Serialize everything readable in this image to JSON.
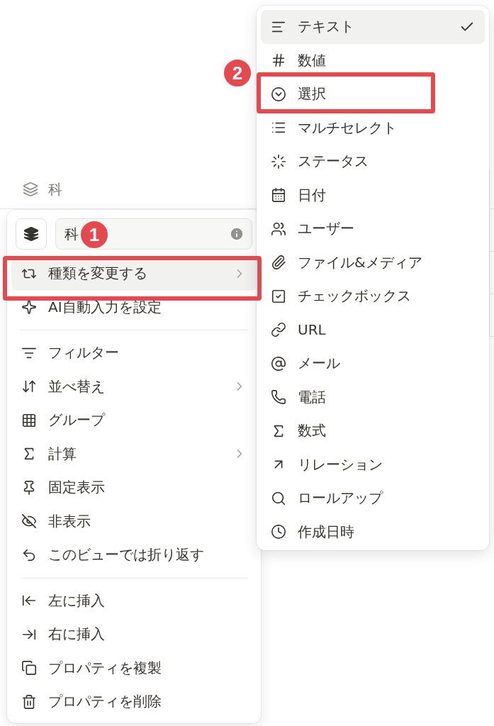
{
  "table": {
    "header": {
      "label": "科"
    }
  },
  "property_menu": {
    "name_field": {
      "value": "科"
    },
    "sections": [
      {
        "items": [
          {
            "label": "種類を変更する",
            "submenu": true,
            "highlighted": true
          },
          {
            "label": "AI自動入力を設定",
            "submenu": false,
            "highlighted": false
          }
        ]
      },
      {
        "items": [
          {
            "label": "フィルター",
            "submenu": false,
            "highlighted": false
          },
          {
            "label": "並べ替え",
            "submenu": true,
            "highlighted": false
          },
          {
            "label": "グループ",
            "submenu": false,
            "highlighted": false
          },
          {
            "label": "計算",
            "submenu": true,
            "highlighted": false
          },
          {
            "label": "固定表示",
            "submenu": false,
            "highlighted": false
          },
          {
            "label": "非表示",
            "submenu": false,
            "highlighted": false
          },
          {
            "label": "このビューでは折り返す",
            "submenu": false,
            "highlighted": false
          }
        ]
      },
      {
        "items": [
          {
            "label": "左に挿入",
            "submenu": false,
            "highlighted": false
          },
          {
            "label": "右に挿入",
            "submenu": false,
            "highlighted": false
          },
          {
            "label": "プロパティを複製",
            "submenu": false,
            "highlighted": false
          },
          {
            "label": "プロパティを削除",
            "submenu": false,
            "highlighted": false
          }
        ]
      }
    ]
  },
  "type_menu": {
    "items": [
      {
        "label": "テキスト",
        "selected": true
      },
      {
        "label": "数値",
        "selected": false
      },
      {
        "label": "選択",
        "selected": false
      },
      {
        "label": "マルチセレクト",
        "selected": false
      },
      {
        "label": "ステータス",
        "selected": false
      },
      {
        "label": "日付",
        "selected": false
      },
      {
        "label": "ユーザー",
        "selected": false
      },
      {
        "label": "ファイル&メディア",
        "selected": false
      },
      {
        "label": "チェックボックス",
        "selected": false
      },
      {
        "label": "URL",
        "selected": false
      },
      {
        "label": "メール",
        "selected": false
      },
      {
        "label": "電話",
        "selected": false
      },
      {
        "label": "数式",
        "selected": false
      },
      {
        "label": "リレーション",
        "selected": false
      },
      {
        "label": "ロールアップ",
        "selected": false
      },
      {
        "label": "作成日時",
        "selected": false
      }
    ]
  },
  "annotations": [
    {
      "label": "1"
    },
    {
      "label": "2"
    }
  ]
}
